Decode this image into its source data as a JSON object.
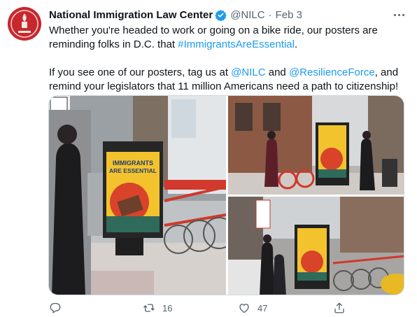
{
  "tweet": {
    "author_name": "National Immigration Law Center",
    "handle": "@NILC",
    "separator": "·",
    "date": "Feb 3",
    "line1_before": "Whether you're headed to work or going on a bike ride, our posters are reminding folks in D.C. that ",
    "hashtag": "#ImmigrantsAreEssential",
    "line1_after": ".",
    "line2_before": "If you see one of our posters, tag us at ",
    "mention_1": "@NILC",
    "line2_and": " and ",
    "mention_2": "@ResilienceForce",
    "line2_after": ", and remind your legislators that 11 million Americans need a path to citizenship!"
  },
  "poster": {
    "line1": "IMMIGRANTS",
    "line2": "ARE ESSENTIAL"
  },
  "actions": {
    "reply_count": "",
    "retweet_count": "16",
    "like_count": "47",
    "share_count": ""
  },
  "icons": {
    "avatar": "nilc-logo",
    "verified": "verified-badge-icon",
    "more": "more-dots-icon",
    "reply": "reply-icon",
    "retweet": "retweet-icon",
    "like": "heart-icon",
    "share": "share-icon"
  },
  "colors": {
    "link": "#1d9bf0",
    "muted": "#536471",
    "avatar_bg": "#c8282d",
    "poster_yellow": "#f3c32e",
    "poster_red": "#d8432a",
    "bike_red": "#d0392b"
  }
}
